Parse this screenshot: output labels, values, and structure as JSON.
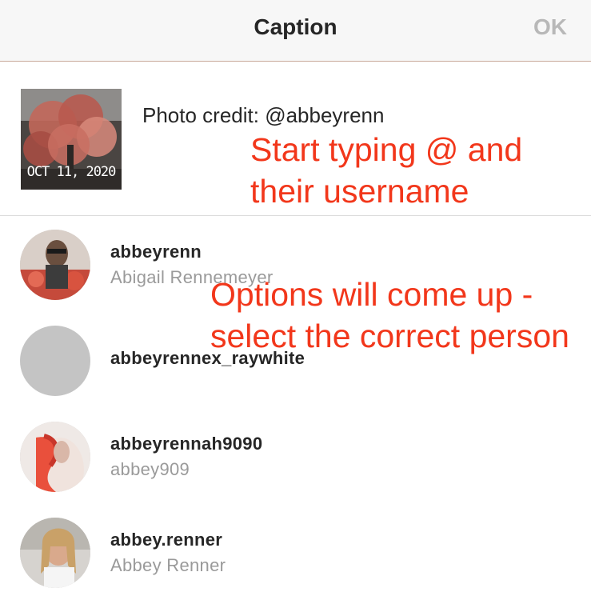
{
  "header": {
    "title": "Caption",
    "ok_label": "OK"
  },
  "compose": {
    "thumbnail_date": "OCT 11, 2020",
    "caption": "Photo credit: @abbeyrenn"
  },
  "annotations": {
    "first": "Start typing @ and their username",
    "second": "Options will come up - select the correct person"
  },
  "suggestions": [
    {
      "username": "abbeyrenn",
      "full_name": "Abigail Rennemeyer"
    },
    {
      "username": "abbeyrennex_raywhite",
      "full_name": ""
    },
    {
      "username": "abbeyrennah9090",
      "full_name": "abbey909"
    },
    {
      "username": "abbey.renner",
      "full_name": "Abbey Renner"
    }
  ],
  "colors": {
    "annotation": "#f2371b",
    "ok_disabled": "#b8b8b8",
    "secondary_text": "#9a9a9a"
  }
}
